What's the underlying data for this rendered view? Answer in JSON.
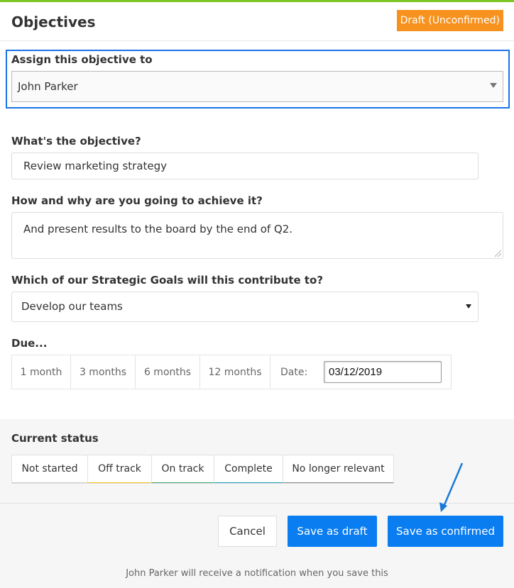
{
  "header": {
    "title": "Objectives",
    "badge": "Draft (Unconfirmed)"
  },
  "assign": {
    "label": "Assign this objective to",
    "value": "John Parker"
  },
  "objective": {
    "label": "What's the objective?",
    "value": "Review marketing strategy"
  },
  "how_why": {
    "label": "How and why are you going to achieve it?",
    "value": "And present results to the board by the end of Q2."
  },
  "strategic_goal": {
    "label": "Which of our Strategic Goals will this contribute to?",
    "value": "Develop our teams"
  },
  "due": {
    "label": "Due...",
    "options": [
      "1 month",
      "3 months",
      "6 months",
      "12 months"
    ],
    "date_label": "Date:",
    "date_value": "03/12/2019"
  },
  "status": {
    "label": "Current status",
    "options": [
      "Not started",
      "Off track",
      "On track",
      "Complete",
      "No longer relevant"
    ],
    "underline_colors": [
      "#cccccc",
      "#f0c419",
      "#3aa76d",
      "#1a9fb5",
      "#888888"
    ]
  },
  "footer": {
    "cancel": "Cancel",
    "save_draft": "Save as draft",
    "save_confirmed": "Save as confirmed",
    "note": "John Parker will receive a notification when you save this"
  },
  "colors": {
    "accent_green": "#7cc628",
    "badge_orange": "#f7921e",
    "primary_blue": "#0a7df1",
    "highlight_blue": "#1a73e8"
  }
}
